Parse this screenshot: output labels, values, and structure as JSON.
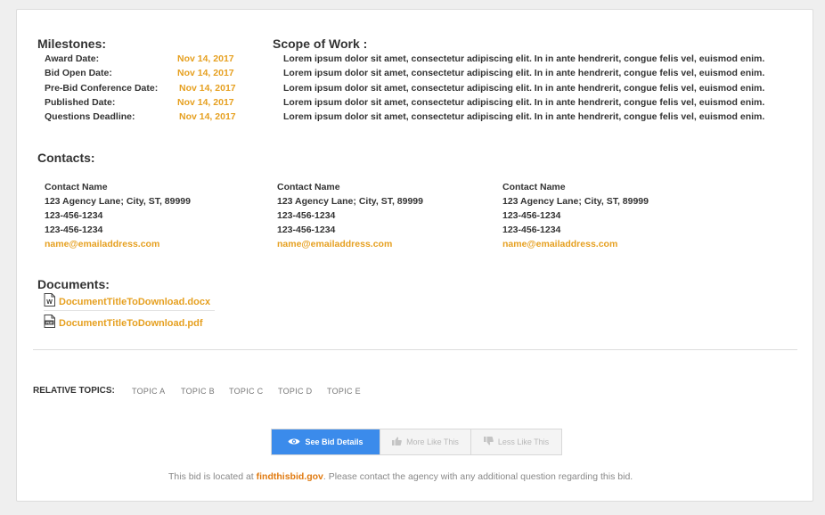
{
  "milestones": {
    "title": "Milestones:",
    "items": [
      {
        "label": "Award Date:",
        "date": "Nov 14, 2017"
      },
      {
        "label": "Bid Open Date:",
        "date": "Nov 14, 2017"
      },
      {
        "label": "Pre-Bid Conference Date:",
        "date": "Nov 14, 2017"
      },
      {
        "label": "Published Date:",
        "date": "Nov 14, 2017"
      },
      {
        "label": "Questions Deadline:",
        "date": "Nov 14, 2017"
      }
    ]
  },
  "scope": {
    "title": "Scope of Work :",
    "lines": [
      "Lorem ipsum dolor sit amet, consectetur adipiscing elit. In in ante hendrerit, congue felis vel, euismod enim.",
      "Lorem ipsum dolor sit amet, consectetur adipiscing elit. In in ante hendrerit, congue felis vel, euismod enim.",
      "Lorem ipsum dolor sit amet, consectetur adipiscing elit. In in ante hendrerit, congue felis vel, euismod enim.",
      "Lorem ipsum dolor sit amet, consectetur adipiscing elit. In in ante hendrerit, congue felis vel, euismod enim.",
      "Lorem ipsum dolor sit amet, consectetur adipiscing elit. In in ante hendrerit, congue felis vel, euismod enim."
    ]
  },
  "contacts": {
    "title": "Contacts:",
    "items": [
      {
        "name": "Contact Name",
        "address": "123 Agency Lane; City, ST, 89999",
        "phone1": "123-456-1234",
        "phone2": "123-456-1234",
        "email": "name@emailaddress.com"
      },
      {
        "name": "Contact Name",
        "address": "123 Agency Lane; City, ST, 89999",
        "phone1": "123-456-1234",
        "phone2": "123-456-1234",
        "email": "name@emailaddress.com"
      },
      {
        "name": "Contact Name",
        "address": "123 Agency Lane; City, ST, 89999",
        "phone1": "123-456-1234",
        "phone2": "123-456-1234",
        "email": "name@emailaddress.com"
      }
    ]
  },
  "documents": {
    "title": "Documents:",
    "items": [
      {
        "name": "DocumentTitleToDownload.docx",
        "icon": "word-doc-icon"
      },
      {
        "name": "DocumentTitleToDownload.pdf",
        "icon": "pdf-doc-icon"
      }
    ]
  },
  "topics": {
    "label": "RELATIVE TOPICS:",
    "items": [
      "TOPIC A",
      "TOPIC B",
      "TOPIC C",
      "TOPIC D",
      "TOPIC E"
    ]
  },
  "actions": {
    "see_details": "See Bid Details",
    "more_like": "More Like This",
    "less_like": "Less Like This"
  },
  "footer": {
    "prefix": "This bid is located at ",
    "site": "findthisbid.gov",
    "suffix": ". Please contact the agency with any additional question regarding this bid."
  },
  "colors": {
    "accent": "#e6a020",
    "primary": "#3b8beb",
    "link": "#e07a10"
  }
}
